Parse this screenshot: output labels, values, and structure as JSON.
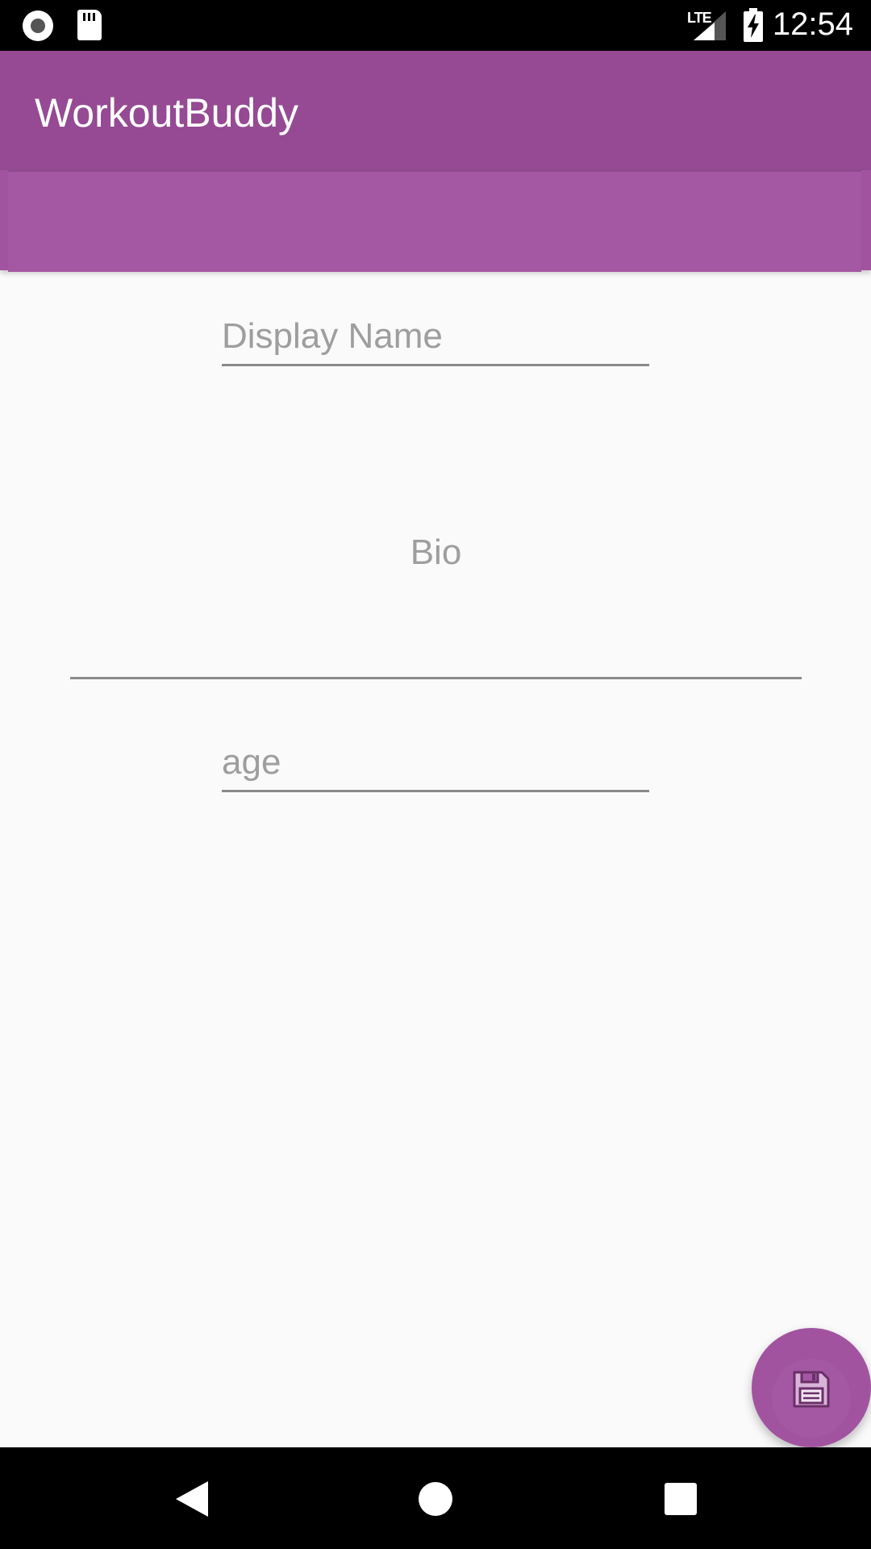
{
  "status_bar": {
    "time": "12:54",
    "network_label": "LTE",
    "icons": [
      "screen-record-icon",
      "sd-card-icon",
      "lte-signal-icon",
      "battery-charging-icon"
    ]
  },
  "app_bar": {
    "title": "WorkoutBuddy"
  },
  "form": {
    "display_name": {
      "placeholder": "Display Name",
      "value": ""
    },
    "bio": {
      "placeholder": "Bio",
      "value": ""
    },
    "age": {
      "placeholder": "age",
      "value": ""
    }
  },
  "fab": {
    "icon": "save-icon"
  },
  "nav_bar": {
    "icons": [
      "back-icon",
      "home-icon",
      "recents-icon"
    ]
  },
  "colors": {
    "primary": "#954a93",
    "primary_light": "#a253a0",
    "background": "#fafafa",
    "hint": "#9e9e9e"
  }
}
